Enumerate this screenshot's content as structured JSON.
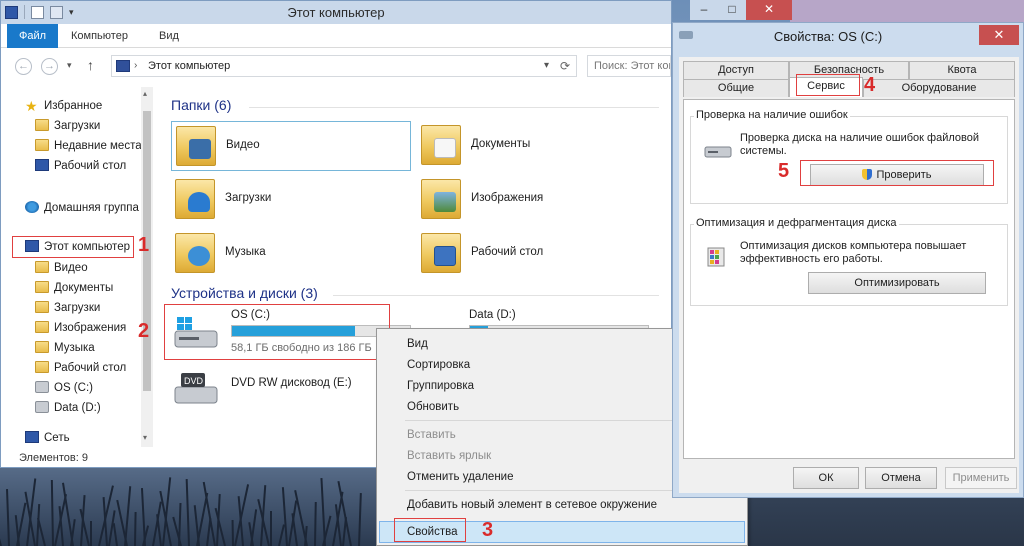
{
  "explorer": {
    "title": "Этот компьютер",
    "ribbon_tabs": [
      "Файл",
      "Компьютер",
      "Вид"
    ],
    "address": "Этот компьютер",
    "search_placeholder": "Поиск: Этот ком",
    "nav": {
      "favorites": "Избранное",
      "downloads": "Загрузки",
      "recent": "Недавние места",
      "desktop": "Рабочий стол",
      "homegroup": "Домашняя группа",
      "this_pc": "Этот компьютер",
      "video": "Видео",
      "documents": "Документы",
      "downloads2": "Загрузки",
      "images": "Изображения",
      "music": "Музыка",
      "desktop2": "Рабочий стол",
      "os_c": "OS (C:)",
      "data_d": "Data (D:)",
      "network": "Сеть"
    },
    "folders_group": "Папки (6)",
    "folders": [
      "Видео",
      "Документы",
      "Загрузки",
      "Изображения",
      "Музыка",
      "Рабочий стол"
    ],
    "devices_group": "Устройства и диски (3)",
    "drive_c": {
      "name": "OS (C:)",
      "free": "58,1 ГБ свободно из 186 ГБ",
      "used_fraction": 0.69
    },
    "drive_d": {
      "name": "Data (D:)",
      "used_fraction": 0.1
    },
    "dvd": {
      "name": "DVD RW дисковод (E:)"
    },
    "status": "Элементов: 9"
  },
  "context_menu": {
    "items": [
      "Вид",
      "Сортировка",
      "Группировка",
      "Обновить"
    ],
    "disabled": [
      "Вставить",
      "Вставить ярлык"
    ],
    "undo": "Отменить удаление",
    "add_net": "Добавить новый элемент в сетевое окружение",
    "properties": "Свойства"
  },
  "properties": {
    "title": "Свойства: OS (C:)",
    "tabs_row1": [
      "Доступ",
      "Безопасность",
      "Квота"
    ],
    "tabs_row2": [
      "Общие",
      "Сервис",
      "Оборудование"
    ],
    "check_group": "Проверка на наличие ошибок",
    "check_text": "Проверка диска на наличие ошибок файловой системы.",
    "check_button": "Проверить",
    "opt_group": "Оптимизация и дефрагментация диска",
    "opt_text": "Оптимизация дисков компьютера повышает эффективность его работы.",
    "opt_button": "Оптимизировать",
    "ok": "ОК",
    "cancel": "Отмена",
    "apply": "Применить"
  },
  "annotations": [
    "1",
    "2",
    "3",
    "4",
    "5"
  ],
  "colors": {
    "accent": "#1979ca",
    "annotation": "#d92b2b",
    "selection": "#cde6f7"
  }
}
